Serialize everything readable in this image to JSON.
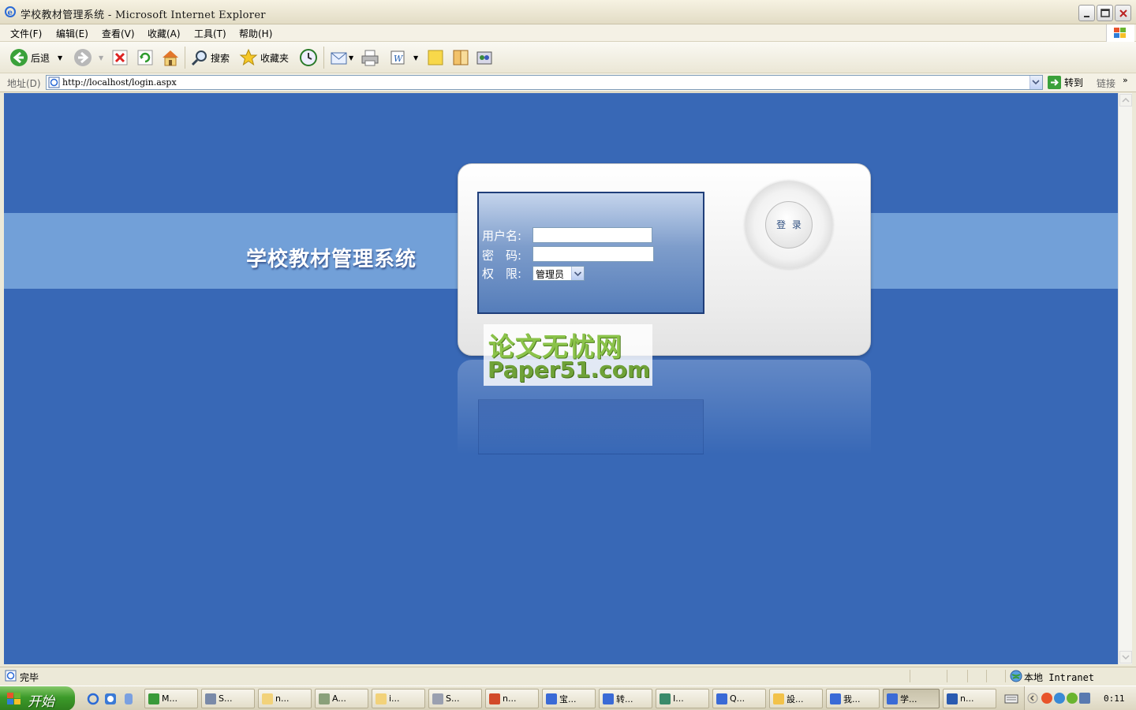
{
  "window": {
    "title": "学校教材管理系统 - Microsoft Internet Explorer"
  },
  "menu": {
    "file": "文件(F)",
    "edit": "编辑(E)",
    "view": "查看(V)",
    "favorites": "收藏(A)",
    "tools": "工具(T)",
    "help": "帮助(H)"
  },
  "toolbar": {
    "back": "后退",
    "search": "搜索",
    "favorites": "收藏夹"
  },
  "address": {
    "label": "地址(D)",
    "url": "http://localhost/login.aspx",
    "go": "转到",
    "links": "链接"
  },
  "page": {
    "system_title": "学校教材管理系统",
    "username_label": "用户名:",
    "password_label": "密　码:",
    "role_label": "权　限:",
    "role_selected": "管理员",
    "login_button": "登 录",
    "watermark_line1": "论文无忧网",
    "watermark_line2": "Paper51.com"
  },
  "status": {
    "text": "完毕",
    "zone": "本地 Intranet"
  },
  "taskbar": {
    "start": "开始",
    "tasks": [
      "M...",
      "S...",
      "n...",
      "A...",
      "i...",
      "S...",
      "n...",
      "宝...",
      "转...",
      "I...",
      "Q...",
      "設...",
      "我...",
      "学...",
      "n..."
    ],
    "clock": "0:11"
  },
  "colors": {
    "page_bg": "#3868B6",
    "band": "#72A0D8",
    "form_border": "#1F3E7A"
  }
}
